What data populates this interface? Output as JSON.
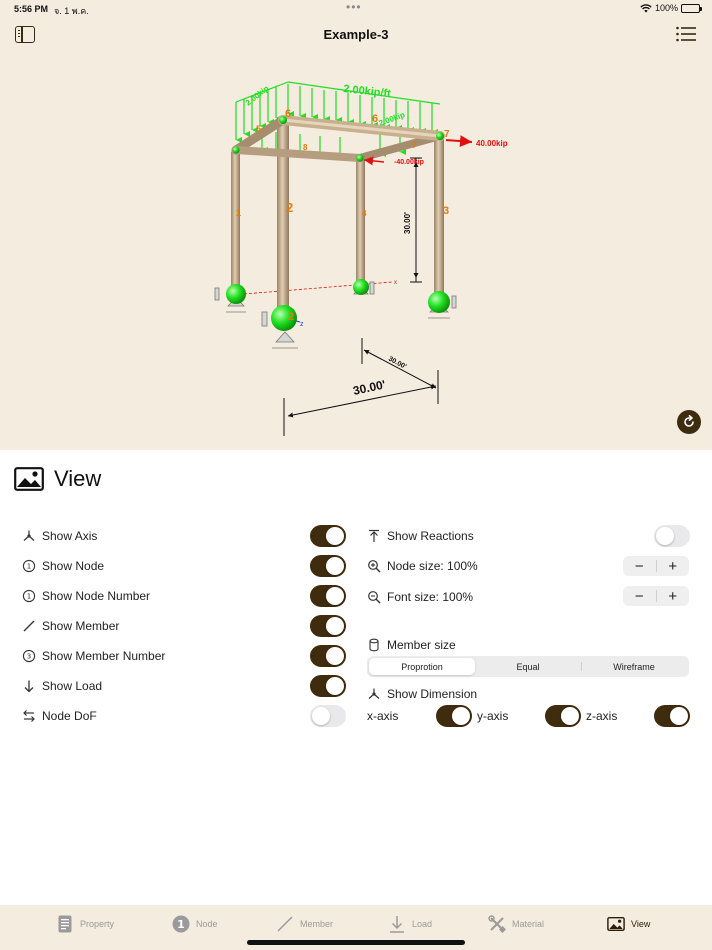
{
  "status": {
    "time": "5:56 PM",
    "date": "จ. 1 พ.ค.",
    "battery": "100%"
  },
  "nav": {
    "title": "Example-3"
  },
  "model": {
    "node_numbers": [
      "1",
      "2",
      "3",
      "4",
      "5",
      "6",
      "7",
      "8"
    ],
    "member_numbers": [
      "1",
      "2",
      "3",
      "4",
      "5",
      "6",
      "7",
      "8"
    ],
    "loads": {
      "distributed": "2.00kip/ft",
      "point_x": "40.00kip",
      "point_z": "-40.00kip",
      "small_left": "2.00kip",
      "small_right": "2.00kip"
    },
    "dimensions": {
      "height": "30.00'",
      "width": "30.00'",
      "depth": "30.00'"
    },
    "axis_labels": {
      "x": "x",
      "z": "z"
    }
  },
  "panel": {
    "title": "View",
    "left_options": [
      {
        "label": "Show Axis",
        "on": true,
        "icon": "axis-icon"
      },
      {
        "label": "Show Node",
        "on": true,
        "icon": "node-circle-icon"
      },
      {
        "label": "Show Node Number",
        "on": true,
        "icon": "node-number-icon"
      },
      {
        "label": "Show Member",
        "on": true,
        "icon": "member-line-icon"
      },
      {
        "label": "Show Member Number",
        "on": true,
        "icon": "member-number-icon"
      },
      {
        "label": "Show Load",
        "on": true,
        "icon": "arrow-down-icon"
      },
      {
        "label": "Node DoF",
        "on": false,
        "icon": "dof-arrows-icon"
      }
    ],
    "show_reactions": {
      "label": "Show Reactions",
      "on": false
    },
    "node_size": {
      "label": "Node size: 100%"
    },
    "font_size": {
      "label": "Font size: 100%"
    },
    "member_size": {
      "label": "Member size",
      "options": [
        "Proprotion",
        "Equal",
        "Wireframe"
      ],
      "selected": "Proprotion"
    },
    "show_dimension": {
      "label": "Show Dimension",
      "axes": [
        {
          "label": "x-axis",
          "on": true
        },
        {
          "label": "y-axis",
          "on": true
        },
        {
          "label": "z-axis",
          "on": true
        }
      ]
    }
  },
  "tabs": [
    {
      "label": "Property",
      "icon": "document-icon",
      "active": false
    },
    {
      "label": "Node",
      "icon": "node-icon",
      "badge": "1",
      "active": false
    },
    {
      "label": "Member",
      "icon": "member-icon",
      "active": false
    },
    {
      "label": "Load",
      "icon": "load-icon",
      "active": false
    },
    {
      "label": "Material",
      "icon": "tools-icon",
      "active": false
    },
    {
      "label": "View",
      "icon": "photo-icon",
      "active": true
    }
  ],
  "colors": {
    "accent": "#3f2b0d",
    "viewport_bg": "#f5ece0",
    "load_green": "#2ee82e",
    "load_red": "#e01010",
    "label_orange": "#e07a10",
    "member": "#cbb497"
  }
}
